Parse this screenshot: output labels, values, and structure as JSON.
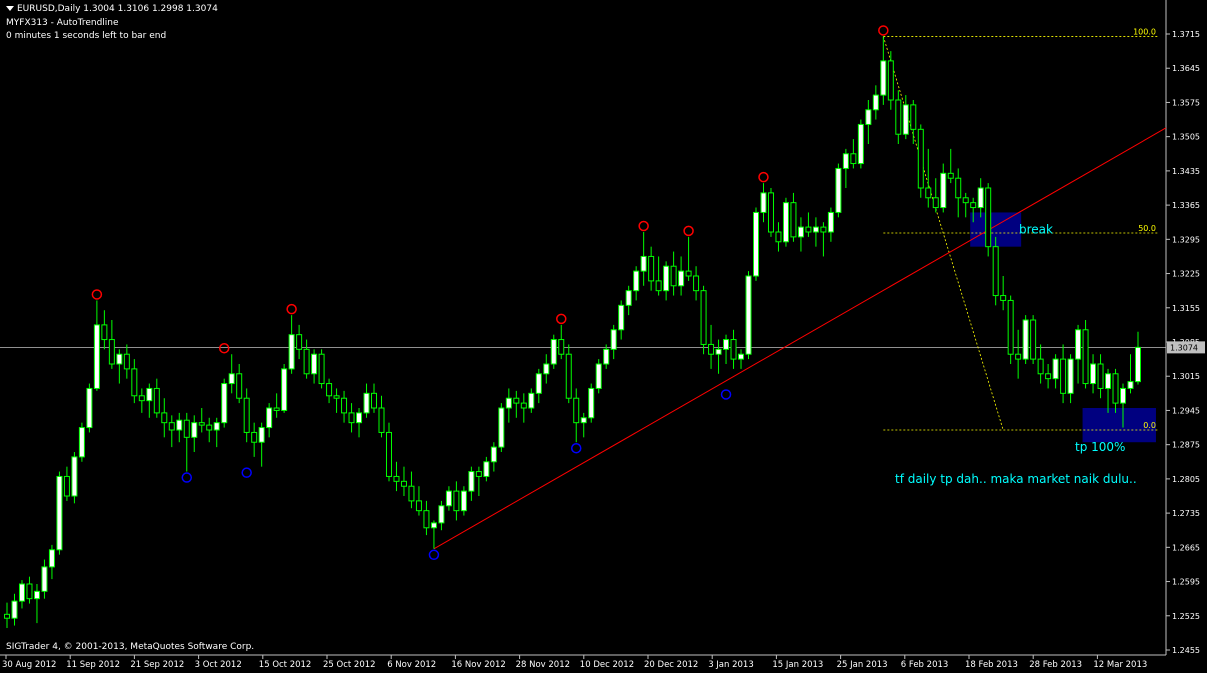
{
  "header": {
    "symbol_line": "EURUSD,Daily  1.3004 1.3106 1.2998 1.3074",
    "indicator": "MYFX313 - AutoTrendline",
    "timer": "0 minutes 1 seconds left to bar end",
    "copyright": "SIGTrader 4, © 2001-2013, MetaQuotes Software Corp."
  },
  "colors": {
    "background": "#000000",
    "candle": "#00ff00",
    "bull_body": "#ffffff",
    "bear_body": "#000000",
    "axis": "#c0c0c0",
    "trendline": "#ff0000",
    "fib": "#ffff00",
    "swing_high": "#ff0000",
    "swing_low": "#0000ff",
    "box": "#000080",
    "annotation": "#00ffff",
    "price_line": "#c0c0c0"
  },
  "chart_data": {
    "type": "candlestick",
    "symbol": "EURUSD",
    "timeframe": "Daily",
    "ylim": [
      1.2455,
      1.3745
    ],
    "y_ticks": [
      "1.3715",
      "1.3645",
      "1.3575",
      "1.3505",
      "1.3435",
      "1.3365",
      "1.3295",
      "1.3225",
      "1.3155",
      "1.3085",
      "1.3015",
      "1.2945",
      "1.2875",
      "1.2805",
      "1.2735",
      "1.2665",
      "1.2595",
      "1.2525",
      "1.2455"
    ],
    "x_ticks": [
      "30 Aug 2012",
      "11 Sep 2012",
      "21 Sep 2012",
      "3 Oct 2012",
      "15 Oct 2012",
      "25 Oct 2012",
      "6 Nov 2012",
      "16 Nov 2012",
      "28 Nov 2012",
      "10 Dec 2012",
      "20 Dec 2012",
      "3 Jan 2013",
      "15 Jan 2013",
      "25 Jan 2013",
      "6 Feb 2013",
      "18 Feb 2013",
      "28 Feb 2013",
      "12 Mar 2013"
    ],
    "current_price": "1.3074",
    "candles": [
      [
        1.2528,
        1.2552,
        1.25,
        1.252
      ],
      [
        1.252,
        1.257,
        1.2505,
        1.2555
      ],
      [
        1.2555,
        1.2598,
        1.254,
        1.259
      ],
      [
        1.259,
        1.2605,
        1.255,
        1.256
      ],
      [
        1.256,
        1.259,
        1.251,
        1.2575
      ],
      [
        1.2575,
        1.264,
        1.256,
        1.2625
      ],
      [
        1.2625,
        1.267,
        1.26,
        1.266
      ],
      [
        1.266,
        1.282,
        1.265,
        1.281
      ],
      [
        1.281,
        1.283,
        1.276,
        1.277
      ],
      [
        1.277,
        1.286,
        1.2755,
        1.285
      ],
      [
        1.285,
        1.292,
        1.284,
        1.291
      ],
      [
        1.291,
        1.3,
        1.29,
        1.299
      ],
      [
        1.299,
        1.317,
        1.2985,
        1.312
      ],
      [
        1.312,
        1.315,
        1.307,
        1.309
      ],
      [
        1.309,
        1.313,
        1.303,
        1.304
      ],
      [
        1.304,
        1.307,
        1.3,
        1.306
      ],
      [
        1.306,
        1.308,
        1.301,
        1.303
      ],
      [
        1.303,
        1.305,
        1.296,
        1.2975
      ],
      [
        1.2975,
        1.299,
        1.294,
        1.2965
      ],
      [
        1.2965,
        1.3,
        1.293,
        1.299
      ],
      [
        1.299,
        1.301,
        1.293,
        1.294
      ],
      [
        1.294,
        1.297,
        1.289,
        1.292
      ],
      [
        1.292,
        1.2935,
        1.287,
        1.2905
      ],
      [
        1.2905,
        1.294,
        1.288,
        1.2925
      ],
      [
        1.2925,
        1.294,
        1.282,
        1.289
      ],
      [
        1.289,
        1.2935,
        1.286,
        1.292
      ],
      [
        1.292,
        1.295,
        1.29,
        1.2915
      ],
      [
        1.2915,
        1.293,
        1.288,
        1.2905
      ],
      [
        1.2905,
        1.293,
        1.287,
        1.292
      ],
      [
        1.292,
        1.301,
        1.291,
        1.3
      ],
      [
        1.3,
        1.306,
        1.298,
        1.302
      ],
      [
        1.302,
        1.304,
        1.296,
        1.297
      ],
      [
        1.297,
        1.299,
        1.288,
        1.29
      ],
      [
        1.29,
        1.292,
        1.285,
        1.288
      ],
      [
        1.288,
        1.292,
        1.283,
        1.291
      ],
      [
        1.291,
        1.296,
        1.289,
        1.295
      ],
      [
        1.295,
        1.298,
        1.293,
        1.2945
      ],
      [
        1.2945,
        1.304,
        1.294,
        1.303
      ],
      [
        1.303,
        1.314,
        1.302,
        1.31
      ],
      [
        1.31,
        1.312,
        1.305,
        1.307
      ],
      [
        1.307,
        1.309,
        1.301,
        1.302
      ],
      [
        1.302,
        1.307,
        1.3,
        1.306
      ],
      [
        1.306,
        1.307,
        1.299,
        1.3
      ],
      [
        1.3,
        1.301,
        1.296,
        1.2975
      ],
      [
        1.2975,
        1.299,
        1.294,
        1.297
      ],
      [
        1.297,
        1.2985,
        1.292,
        1.294
      ],
      [
        1.294,
        1.296,
        1.29,
        1.292
      ],
      [
        1.292,
        1.295,
        1.289,
        1.294
      ],
      [
        1.294,
        1.3,
        1.293,
        1.298
      ],
      [
        1.298,
        1.3,
        1.294,
        1.295
      ],
      [
        1.295,
        1.2975,
        1.289,
        1.29
      ],
      [
        1.29,
        1.292,
        1.28,
        1.281
      ],
      [
        1.281,
        1.284,
        1.278,
        1.28
      ],
      [
        1.28,
        1.283,
        1.277,
        1.279
      ],
      [
        1.279,
        1.282,
        1.2745,
        1.276
      ],
      [
        1.276,
        1.279,
        1.273,
        1.274
      ],
      [
        1.274,
        1.276,
        1.269,
        1.2705
      ],
      [
        1.2705,
        1.272,
        1.2662,
        1.2715
      ],
      [
        1.2715,
        1.276,
        1.27,
        1.275
      ],
      [
        1.275,
        1.279,
        1.274,
        1.278
      ],
      [
        1.278,
        1.28,
        1.272,
        1.274
      ],
      [
        1.274,
        1.279,
        1.273,
        1.278
      ],
      [
        1.278,
        1.283,
        1.276,
        1.282
      ],
      [
        1.282,
        1.283,
        1.277,
        1.281
      ],
      [
        1.281,
        1.285,
        1.28,
        1.284
      ],
      [
        1.284,
        1.288,
        1.282,
        1.287
      ],
      [
        1.287,
        1.296,
        1.286,
        1.295
      ],
      [
        1.295,
        1.299,
        1.292,
        1.297
      ],
      [
        1.297,
        1.2985,
        1.293,
        1.296
      ],
      [
        1.296,
        1.298,
        1.292,
        1.295
      ],
      [
        1.295,
        1.299,
        1.294,
        1.298
      ],
      [
        1.298,
        1.303,
        1.296,
        1.302
      ],
      [
        1.302,
        1.306,
        1.3,
        1.304
      ],
      [
        1.304,
        1.31,
        1.303,
        1.309
      ],
      [
        1.309,
        1.312,
        1.305,
        1.306
      ],
      [
        1.306,
        1.308,
        1.296,
        1.297
      ],
      [
        1.297,
        1.299,
        1.288,
        1.292
      ],
      [
        1.292,
        1.294,
        1.289,
        1.293
      ],
      [
        1.293,
        1.3,
        1.292,
        1.299
      ],
      [
        1.299,
        1.305,
        1.298,
        1.304
      ],
      [
        1.304,
        1.308,
        1.303,
        1.307
      ],
      [
        1.307,
        1.312,
        1.305,
        1.311
      ],
      [
        1.311,
        1.317,
        1.309,
        1.316
      ],
      [
        1.316,
        1.32,
        1.314,
        1.319
      ],
      [
        1.319,
        1.324,
        1.317,
        1.323
      ],
      [
        1.323,
        1.331,
        1.32,
        1.326
      ],
      [
        1.326,
        1.328,
        1.319,
        1.321
      ],
      [
        1.321,
        1.326,
        1.318,
        1.319
      ],
      [
        1.319,
        1.325,
        1.317,
        1.324
      ],
      [
        1.324,
        1.327,
        1.318,
        1.32
      ],
      [
        1.32,
        1.326,
        1.318,
        1.323
      ],
      [
        1.323,
        1.33,
        1.321,
        1.322
      ],
      [
        1.322,
        1.324,
        1.317,
        1.319
      ],
      [
        1.319,
        1.32,
        1.306,
        1.308
      ],
      [
        1.308,
        1.312,
        1.303,
        1.306
      ],
      [
        1.306,
        1.309,
        1.302,
        1.307
      ],
      [
        1.307,
        1.31,
        1.304,
        1.309
      ],
      [
        1.309,
        1.311,
        1.303,
        1.305
      ],
      [
        1.305,
        1.307,
        1.303,
        1.306
      ],
      [
        1.306,
        1.323,
        1.305,
        1.322
      ],
      [
        1.322,
        1.336,
        1.321,
        1.335
      ],
      [
        1.335,
        1.341,
        1.333,
        1.339
      ],
      [
        1.339,
        1.34,
        1.33,
        1.331
      ],
      [
        1.331,
        1.333,
        1.327,
        1.329
      ],
      [
        1.329,
        1.338,
        1.328,
        1.337
      ],
      [
        1.337,
        1.339,
        1.329,
        1.33
      ],
      [
        1.33,
        1.334,
        1.327,
        1.332
      ],
      [
        1.332,
        1.335,
        1.33,
        1.331
      ],
      [
        1.331,
        1.334,
        1.328,
        1.332
      ],
      [
        1.332,
        1.333,
        1.326,
        1.331
      ],
      [
        1.331,
        1.336,
        1.329,
        1.335
      ],
      [
        1.335,
        1.345,
        1.334,
        1.344
      ],
      [
        1.344,
        1.348,
        1.34,
        1.347
      ],
      [
        1.347,
        1.35,
        1.344,
        1.345
      ],
      [
        1.345,
        1.354,
        1.344,
        1.353
      ],
      [
        1.353,
        1.358,
        1.349,
        1.356
      ],
      [
        1.356,
        1.361,
        1.354,
        1.359
      ],
      [
        1.359,
        1.371,
        1.357,
        1.366
      ],
      [
        1.366,
        1.368,
        1.356,
        1.358
      ],
      [
        1.358,
        1.36,
        1.349,
        1.351
      ],
      [
        1.351,
        1.359,
        1.35,
        1.357
      ],
      [
        1.357,
        1.358,
        1.349,
        1.352
      ],
      [
        1.352,
        1.353,
        1.338,
        1.34
      ],
      [
        1.34,
        1.348,
        1.336,
        1.338
      ],
      [
        1.338,
        1.342,
        1.335,
        1.336
      ],
      [
        1.336,
        1.345,
        1.335,
        1.343
      ],
      [
        1.343,
        1.348,
        1.341,
        1.342
      ],
      [
        1.342,
        1.344,
        1.334,
        1.338
      ],
      [
        1.338,
        1.339,
        1.334,
        1.337
      ],
      [
        1.337,
        1.338,
        1.333,
        1.336
      ],
      [
        1.336,
        1.342,
        1.334,
        1.34
      ],
      [
        1.34,
        1.341,
        1.326,
        1.328
      ],
      [
        1.328,
        1.33,
        1.316,
        1.318
      ],
      [
        1.318,
        1.322,
        1.315,
        1.317
      ],
      [
        1.317,
        1.318,
        1.304,
        1.306
      ],
      [
        1.306,
        1.311,
        1.301,
        1.305
      ],
      [
        1.305,
        1.314,
        1.304,
        1.313
      ],
      [
        1.313,
        1.314,
        1.304,
        1.305
      ],
      [
        1.305,
        1.308,
        1.3,
        1.302
      ],
      [
        1.302,
        1.304,
        1.299,
        1.301
      ],
      [
        1.301,
        1.306,
        1.299,
        1.305
      ],
      [
        1.305,
        1.308,
        1.296,
        1.298
      ],
      [
        1.298,
        1.306,
        1.296,
        1.305
      ],
      [
        1.305,
        1.312,
        1.3,
        1.311
      ],
      [
        1.311,
        1.313,
        1.299,
        1.3
      ],
      [
        1.3,
        1.306,
        1.298,
        1.304
      ],
      [
        1.304,
        1.306,
        1.297,
        1.299
      ],
      [
        1.299,
        1.303,
        1.294,
        1.302
      ],
      [
        1.302,
        1.303,
        1.294,
        1.296
      ],
      [
        1.296,
        1.3,
        1.291,
        1.299
      ],
      [
        1.299,
        1.306,
        1.298,
        1.3004
      ],
      [
        1.3004,
        1.3106,
        1.2998,
        1.3074
      ]
    ],
    "swing_highs": [
      {
        "i": 12,
        "price": 1.317
      },
      {
        "i": 29,
        "price": 1.306
      },
      {
        "i": 38,
        "price": 1.314
      },
      {
        "i": 74,
        "price": 1.312
      },
      {
        "i": 85,
        "price": 1.331
      },
      {
        "i": 91,
        "price": 1.33
      },
      {
        "i": 101,
        "price": 1.341
      },
      {
        "i": 117,
        "price": 1.371
      }
    ],
    "swing_lows": [
      {
        "i": 24,
        "price": 1.282
      },
      {
        "i": 32,
        "price": 1.283
      },
      {
        "i": 57,
        "price": 1.2662
      },
      {
        "i": 76,
        "price": 1.288
      },
      {
        "i": 96,
        "price": 1.299
      }
    ],
    "trendline": {
      "from": {
        "i": 57,
        "price": 1.2662
      },
      "to_price_at_right_edge": 1.3523
    },
    "fibonacci": {
      "high": 1.371,
      "low": 1.2905,
      "levels": [
        {
          "label": "100.0",
          "price": 1.371
        },
        {
          "label": "50.0",
          "price": 1.3308
        },
        {
          "label": "0.0",
          "price": 1.2905
        }
      ]
    },
    "annotations": [
      {
        "text": "break",
        "price": 1.3315
      },
      {
        "text": "tp 100%",
        "price": 1.287
      },
      {
        "text": "tf daily tp dah.. maka market naik dulu..",
        "price": 1.2805
      }
    ],
    "boxes": [
      {
        "name": "break-box",
        "from_i": 129,
        "to_i": 135,
        "top": 1.335,
        "bottom": 1.328
      },
      {
        "name": "tp-box",
        "from_i": 144,
        "to_i": 153,
        "top": 1.295,
        "bottom": 1.288
      }
    ]
  }
}
